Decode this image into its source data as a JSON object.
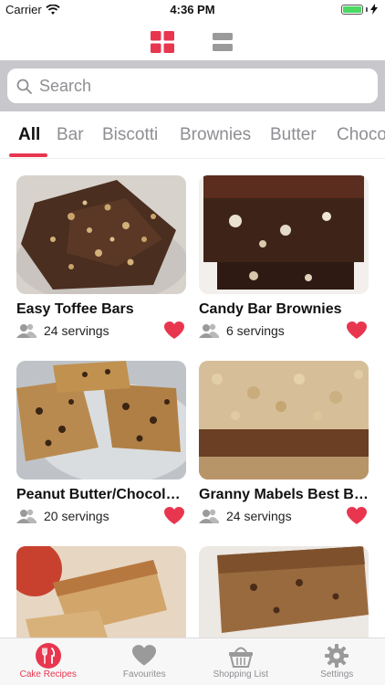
{
  "status": {
    "carrier": "Carrier",
    "time": "4:36 PM"
  },
  "search": {
    "placeholder": "Search"
  },
  "categories": [
    "All",
    "Bar",
    "Biscotti",
    "Brownies",
    "Butter",
    "Choco"
  ],
  "recipes": [
    {
      "title": "Easy Toffee Bars",
      "servings": "24 servings"
    },
    {
      "title": "Candy Bar Brownies",
      "servings": "6 servings"
    },
    {
      "title": "Peanut Butter/Chocol…",
      "servings": "20 servings"
    },
    {
      "title": "Granny Mabels Best B…",
      "servings": "24 servings"
    }
  ],
  "tabbar": {
    "items": [
      {
        "label": "Cake Recipes",
        "icon": "fork-knife-icon"
      },
      {
        "label": "Favourites",
        "icon": "heart-icon"
      },
      {
        "label": "Shopping List",
        "icon": "basket-icon"
      },
      {
        "label": "Settings",
        "icon": "gear-icon"
      }
    ]
  },
  "colors": {
    "accent": "#e8364f",
    "inactive": "#8e8e93",
    "search_bg": "#c8c7cc"
  }
}
